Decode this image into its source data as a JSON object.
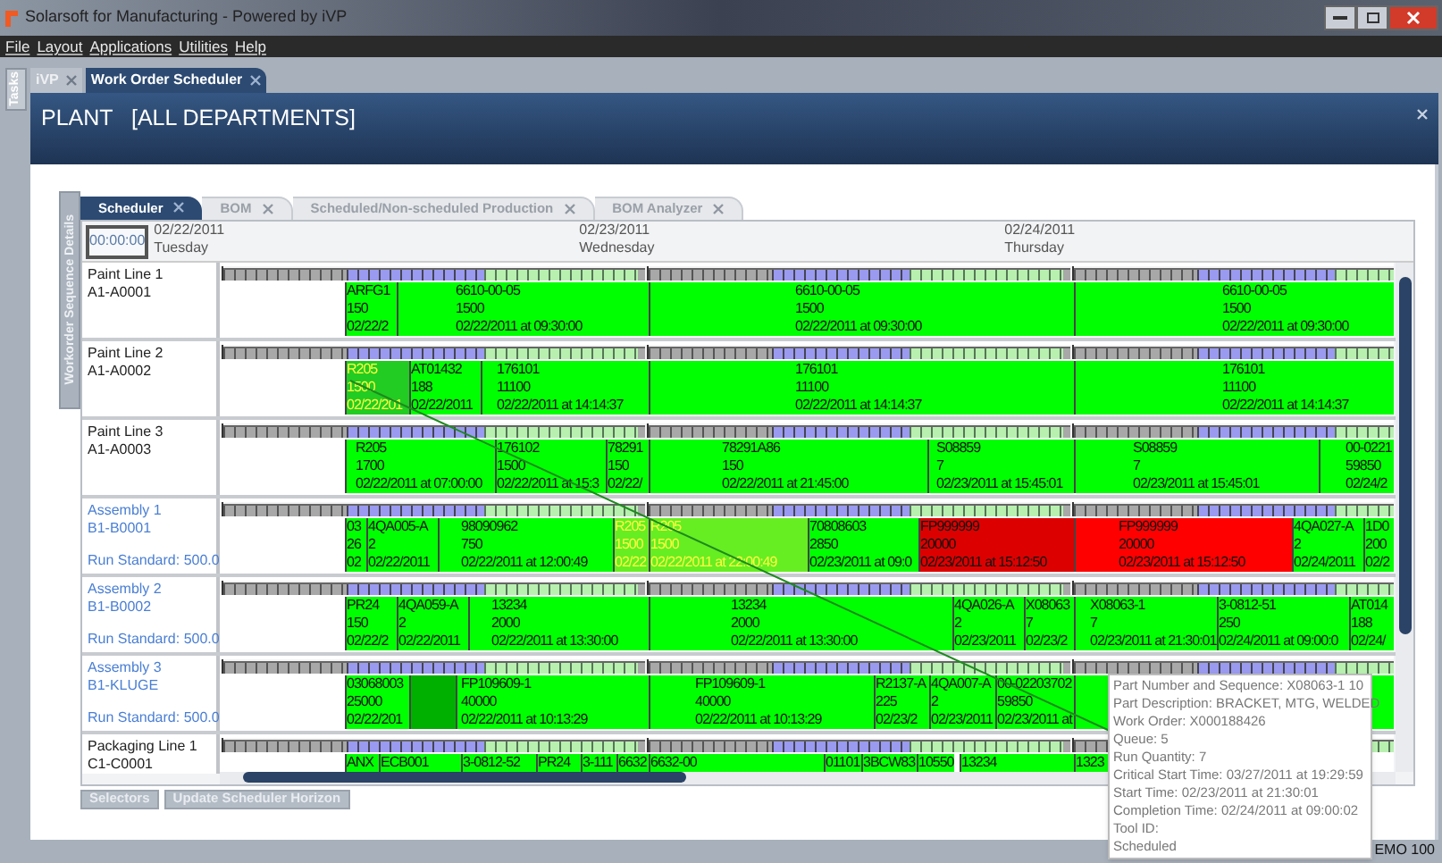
{
  "window": {
    "title": "Solarsoft for Manufacturing - Powered by iVP"
  },
  "menu": [
    "File",
    "Layout",
    "Applications",
    "Utilities",
    "Help"
  ],
  "side_tab": "Tasks",
  "doc_tabs": [
    {
      "label": "iVP",
      "selected": false
    },
    {
      "label": "Work Order Scheduler",
      "selected": true
    }
  ],
  "header": {
    "title": "PLANT   [ALL DEPARTMENTS]"
  },
  "details_tab": "Workorder Sequence Details",
  "tabs": [
    {
      "label": "Scheduler",
      "selected": true
    },
    {
      "label": "BOM",
      "selected": false
    },
    {
      "label": "Scheduled/Non-scheduled Production",
      "selected": false
    },
    {
      "label": "BOM Analyzer",
      "selected": false
    }
  ],
  "scheduler": {
    "time": "00:00:00",
    "days": [
      {
        "date": "02/22/2011",
        "weekday": "Tuesday"
      },
      {
        "date": "02/23/2011",
        "weekday": "Wednesday"
      },
      {
        "date": "02/24/2011",
        "weekday": "Thursday"
      }
    ],
    "resources": [
      {
        "kind": "line",
        "name": "Paint Line 1",
        "code": "A1-A0001",
        "blocks": [
          {
            "lines": [
              "ARFG1",
              "150",
              "02/22/2"
            ],
            "color": "#00ff00",
            "highlighted": false
          },
          {
            "lines": [
              "6610-00-05",
              "1500",
              "02/22/2011 at 09:30:00"
            ],
            "color": "#00ff00",
            "highlighted": false
          },
          {
            "lines": [
              "6610-00-05",
              "1500",
              "02/22/2011 at 09:30:00"
            ],
            "color": "#00ff00",
            "highlighted": false
          },
          {
            "lines": [
              "6610-00-05",
              "1500",
              "02/22/2011 at 09:30:00"
            ],
            "color": "#00ff00",
            "highlighted": false
          }
        ]
      },
      {
        "kind": "line",
        "name": "Paint Line 2",
        "code": "A1-A0002",
        "blocks": [
          {
            "lines": [
              "R205",
              "1500",
              "02/22/201"
            ],
            "color": "#22cc22",
            "highlighted": true
          },
          {
            "lines": [
              "AT01432",
              "188",
              "02/22/2011"
            ],
            "color": "#00ff00",
            "highlighted": false
          },
          {
            "lines": [
              "176101",
              "11100",
              "02/22/2011 at 14:14:37"
            ],
            "color": "#00ff00",
            "highlighted": false
          },
          {
            "lines": [
              "176101",
              "11100",
              "02/22/2011 at 14:14:37"
            ],
            "color": "#00ff00",
            "highlighted": false
          },
          {
            "lines": [
              "176101",
              "11100",
              "02/22/2011 at 14:14:37"
            ],
            "color": "#00ff00",
            "highlighted": false
          }
        ]
      },
      {
        "kind": "line",
        "name": "Paint Line 3",
        "code": "A1-A0003",
        "blocks": [
          {
            "lines": [
              "R205",
              "1700",
              "02/22/2011 at 07:00:00"
            ],
            "color": "#00ff00",
            "highlighted": false
          },
          {
            "lines": [
              "176102",
              "1500",
              "02/22/2011 at 15:3"
            ],
            "color": "#00ff00",
            "highlighted": false
          },
          {
            "lines": [
              "78291",
              "150",
              "02/22/"
            ],
            "color": "#00ff00",
            "highlighted": false
          },
          {
            "lines": [
              "78291A86",
              "150",
              "02/22/2011 at 21:45:00"
            ],
            "color": "#00ff00",
            "highlighted": false
          },
          {
            "lines": [
              "S08859",
              "7",
              "02/23/2011 at 15:45:01"
            ],
            "color": "#00ff00",
            "highlighted": false
          },
          {
            "lines": [
              "S08859",
              "7",
              "02/23/2011 at 15:45:01"
            ],
            "color": "#00ff00",
            "highlighted": false
          },
          {
            "lines": [
              "00-0221",
              "59850",
              "02/24/2"
            ],
            "color": "#00ff00",
            "highlighted": false
          }
        ]
      },
      {
        "kind": "assembly",
        "name": "Assembly 1",
        "code": "B1-B0001",
        "standard": "Run Standard: 500.0",
        "blocks": [
          {
            "lines": [
              "03",
              "26",
              "02"
            ],
            "color": "#00ff00",
            "highlighted": false
          },
          {
            "lines": [
              "4QA005-A",
              "2",
              "02/22/2011"
            ],
            "color": "#00ff00",
            "highlighted": false
          },
          {
            "lines": [
              "98090962",
              "750",
              "02/22/2011 at 12:00:49"
            ],
            "color": "#00ff00",
            "highlighted": false
          },
          {
            "lines": [
              "R205",
              "1500",
              "02/22"
            ],
            "color": "#66ee22",
            "highlighted": true
          },
          {
            "lines": [
              "R205",
              "1500",
              "02/22/2011 at 22:00:49"
            ],
            "color": "#66ee22",
            "highlighted": true
          },
          {
            "lines": [
              "70808603",
              "2850",
              "02/23/2011 at 09:0"
            ],
            "color": "#00ff00",
            "highlighted": false
          },
          {
            "lines": [
              "FP999999",
              "20000",
              "02/23/2011 at 15:12:50"
            ],
            "color": "#dd0000",
            "highlighted": false
          },
          {
            "lines": [
              "FP999999",
              "20000",
              "02/23/2011 at 15:12:50"
            ],
            "color": "#ff0000",
            "highlighted": false
          },
          {
            "lines": [
              "4QA027-A",
              "2",
              "02/24/2011"
            ],
            "color": "#00ff00",
            "highlighted": false
          },
          {
            "lines": [
              "1D0",
              "200",
              "02/2"
            ],
            "color": "#00ff00",
            "highlighted": false
          }
        ]
      },
      {
        "kind": "assembly",
        "name": "Assembly 2",
        "code": "B1-B0002",
        "standard": "Run Standard: 500.0",
        "blocks": [
          {
            "lines": [
              "PR24",
              "150",
              "02/22/2"
            ],
            "color": "#00ff00",
            "highlighted": false
          },
          {
            "lines": [
              "4QA059-A",
              "2",
              "02/22/2011"
            ],
            "color": "#00ff00",
            "highlighted": false
          },
          {
            "lines": [
              "13234",
              "2000",
              "02/22/2011 at 13:30:00"
            ],
            "color": "#00ff00",
            "highlighted": false
          },
          {
            "lines": [
              "13234",
              "2000",
              "02/22/2011 at 13:30:00"
            ],
            "color": "#00ff00",
            "highlighted": false
          },
          {
            "lines": [
              "4QA026-A",
              "2",
              "02/23/2011"
            ],
            "color": "#00ff00",
            "highlighted": false
          },
          {
            "lines": [
              "X08063",
              "7",
              "02/23/2"
            ],
            "color": "#00ff00",
            "highlighted": false
          },
          {
            "lines": [
              "X08063-1",
              "7",
              "02/23/2011 at 21:30:01"
            ],
            "color": "#00ff00",
            "highlighted": false
          },
          {
            "lines": [
              "3-0812-51",
              "250",
              "02/24/2011 at 09:00:0"
            ],
            "color": "#00ff00",
            "highlighted": false
          },
          {
            "lines": [
              "AT014",
              "188",
              "02/24/"
            ],
            "color": "#00ff00",
            "highlighted": false
          }
        ]
      },
      {
        "kind": "assembly",
        "name": "Assembly 3",
        "code": "B1-KLUGE",
        "standard": "Run Standard: 500.0",
        "blocks": [
          {
            "lines": [
              "03068003",
              "25000",
              "02/22/201"
            ],
            "color": "#00ff00",
            "highlighted": false
          },
          {
            "color": "#00b000"
          },
          {
            "lines": [
              "FP109609-1",
              "40000",
              "02/22/2011 at 10:13:29"
            ],
            "color": "#00ff00",
            "highlighted": false
          },
          {
            "lines": [
              "FP109609-1",
              "40000",
              "02/22/2011 at 10:13:29"
            ],
            "color": "#00ff00",
            "highlighted": false
          },
          {
            "lines": [
              "R2137-A",
              "225",
              "02/23/2"
            ],
            "color": "#00ff00",
            "highlighted": false
          },
          {
            "lines": [
              "4QA007-A",
              "2",
              "02/23/2011"
            ],
            "color": "#00ff00",
            "highlighted": false
          },
          {
            "lines": [
              "00-02203702",
              "59850",
              "02/23/2011 at"
            ],
            "color": "#00ff00",
            "highlighted": false
          },
          {
            "color": "#00ff00"
          }
        ]
      },
      {
        "kind": "line",
        "name": "Packaging Line 1",
        "code": "C1-C0001",
        "blocks": [
          {
            "lines": [
              "ANX"
            ],
            "color": "#00ff00",
            "highlighted": false
          },
          {
            "lines": [
              "ECB001"
            ],
            "color": "#00ff00",
            "highlighted": false
          },
          {
            "lines": [
              "3-0812-52"
            ],
            "color": "#00ff00",
            "highlighted": false
          },
          {
            "lines": [
              "PR24"
            ],
            "color": "#00ff00",
            "highlighted": false
          },
          {
            "lines": [
              "3-111"
            ],
            "color": "#00ff00",
            "highlighted": false
          },
          {
            "lines": [
              "6632"
            ],
            "color": "#00ff00",
            "highlighted": false
          },
          {
            "lines": [
              "6632-00"
            ],
            "color": "#00ff00",
            "highlighted": false
          },
          {
            "lines": [
              "01101"
            ],
            "color": "#00ff00",
            "highlighted": false
          },
          {
            "lines": [
              "3BCW83"
            ],
            "color": "#00ff00",
            "highlighted": false
          },
          {
            "lines": [
              "10550"
            ],
            "color": "#00ff00",
            "highlighted": false
          },
          {
            "lines": [
              "13234"
            ],
            "color": "#00ff00",
            "highlighted": false
          },
          {
            "lines": [
              "1323"
            ],
            "color": "#00ff00",
            "highlighted": false
          }
        ]
      }
    ]
  },
  "buttons": [
    "Selectors",
    "Update Scheduler Horizon"
  ],
  "tooltip": [
    "Part Number and Sequence: X08063-1 10",
    "Part Description: BRACKET, MTG, WELDED",
    "Work Order: X000188426",
    "Queue: 5",
    "Run Quantity: 7",
    "Critical Start Time: 03/27/2011 at 19:29:59",
    "Start Time: 02/23/2011 at 21:30:01",
    "Completion Time: 02/24/2011 at 09:00:02",
    "Tool ID:",
    "Scheduled"
  ],
  "status": "EMO 100"
}
